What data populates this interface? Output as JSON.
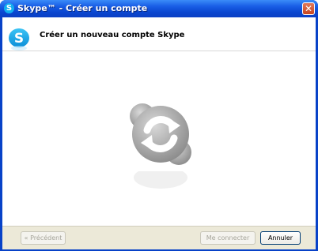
{
  "window": {
    "title": "Skype™ - Créer un compte",
    "close_symbol": "✕",
    "app_icon": "skype-icon",
    "app_icon_letter": "S"
  },
  "header": {
    "title": "Créer un nouveau compte Skype",
    "logo": "skype-logo"
  },
  "main": {
    "status_icon": "sync-loading-icon"
  },
  "footer": {
    "prev_label": "« Précédent",
    "connect_label": "Me connecter",
    "cancel_label": "Annuler"
  },
  "colors": {
    "titlebar": "#0a46d0",
    "skype_blue": "#12aff0",
    "footer_bg": "#ece9d8"
  }
}
